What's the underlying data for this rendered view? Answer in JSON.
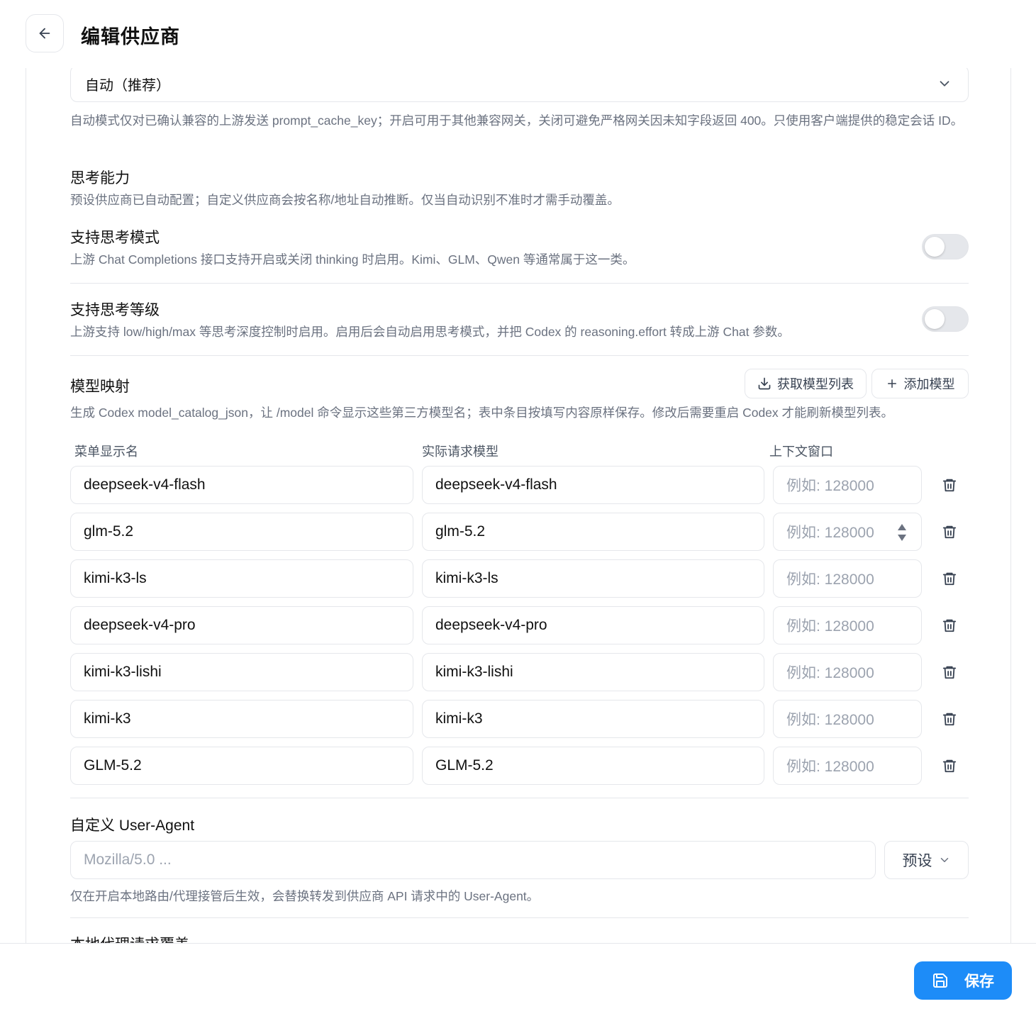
{
  "header": {
    "title": "编辑供应商"
  },
  "cache_mode": {
    "selected": "自动（推荐）",
    "help": "自动模式仅对已确认兼容的上游发送 prompt_cache_key；开启可用于其他兼容网关，关闭可避免严格网关因未知字段返回 400。只使用客户端提供的稳定会话 ID。"
  },
  "thinking": {
    "title": "思考能力",
    "help": "预设供应商已自动配置；自定义供应商会按名称/地址自动推断。仅当自动识别不准时才需手动覆盖。",
    "mode": {
      "label": "支持思考模式",
      "help": "上游 Chat Completions 接口支持开启或关闭 thinking 时启用。Kimi、GLM、Qwen 等通常属于这一类。",
      "enabled": false
    },
    "level": {
      "label": "支持思考等级",
      "help": "上游支持 low/high/max 等思考深度控制时启用。启用后会自动启用思考模式，并把 Codex 的 reasoning.effort 转成上游 Chat 参数。",
      "enabled": false
    }
  },
  "model_mapping": {
    "title": "模型映射",
    "fetch_label": "获取模型列表",
    "add_label": "添加模型",
    "help": "生成 Codex model_catalog_json，让 /model 命令显示这些第三方模型名；表中条目按填写内容原样保存。修改后需要重启 Codex 才能刷新模型列表。",
    "columns": [
      "菜单显示名",
      "实际请求模型",
      "上下文窗口"
    ],
    "context_placeholder": "例如: 128000",
    "rows": [
      {
        "display": "deepseek-v4-flash",
        "model": "deepseek-v4-flash",
        "context": ""
      },
      {
        "display": "glm-5.2",
        "model": "glm-5.2",
        "context": ""
      },
      {
        "display": "kimi-k3-ls",
        "model": "kimi-k3-ls",
        "context": ""
      },
      {
        "display": "deepseek-v4-pro",
        "model": "deepseek-v4-pro",
        "context": ""
      },
      {
        "display": "kimi-k3-lishi",
        "model": "kimi-k3-lishi",
        "context": ""
      },
      {
        "display": "kimi-k3",
        "model": "kimi-k3",
        "context": ""
      },
      {
        "display": "GLM-5.2",
        "model": "GLM-5.2",
        "context": ""
      }
    ]
  },
  "user_agent": {
    "title": "自定义 User-Agent",
    "placeholder": "Mozilla/5.0 ...",
    "preset_label": "预设",
    "help": "仅在开启本地路由/代理接管后生效，会替换转发到供应商 API 请求中的 User-Agent。"
  },
  "next_section": {
    "title": "本地代理请求覆盖"
  },
  "footer": {
    "save_label": "保存"
  },
  "colors": {
    "accent": "#1d8cf8",
    "border": "#e5e7eb",
    "muted": "#6b7280"
  }
}
